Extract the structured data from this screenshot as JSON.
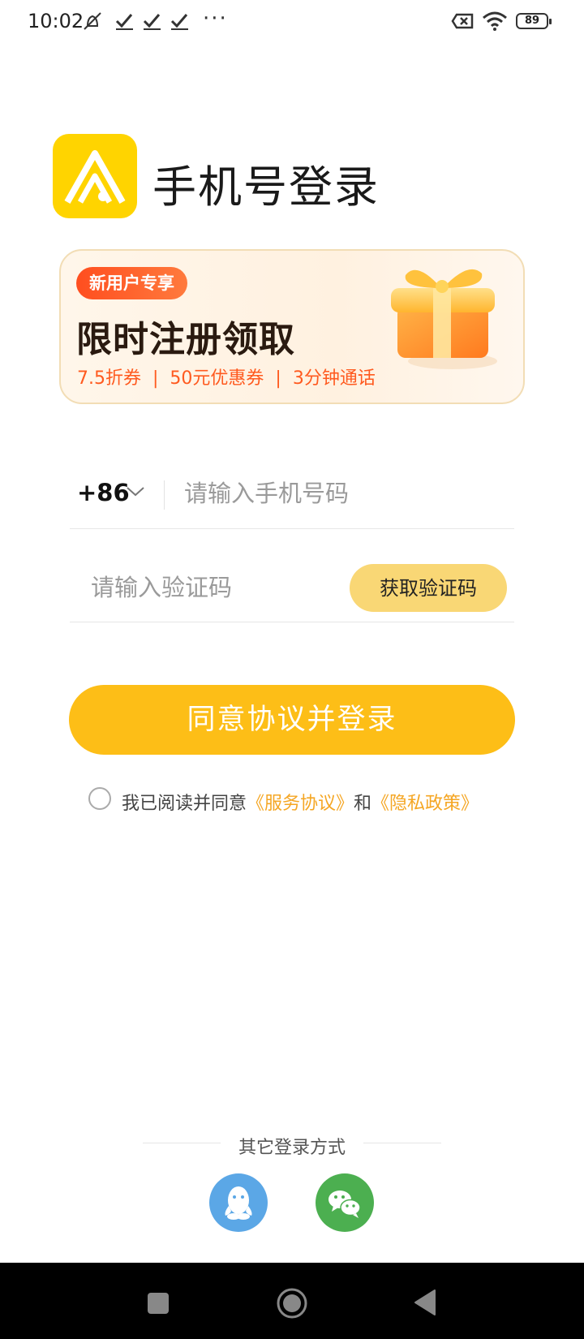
{
  "status_bar": {
    "time": "10:02",
    "battery": "89",
    "icons": [
      "mute-icon",
      "check-icon",
      "check-icon",
      "check-icon",
      "more-dots-icon",
      "sim-none-icon",
      "wifi-icon",
      "battery-icon"
    ]
  },
  "header": {
    "title": "手机号登录",
    "logo_color": "#FFD400"
  },
  "promo": {
    "badge": "新用户专享",
    "title": "限时注册领取",
    "perks": [
      "7.5折券",
      "50元优惠券",
      "3分钟通话"
    ],
    "separator": "|"
  },
  "form": {
    "country_code": "+86",
    "phone_placeholder": "请输入手机号码",
    "phone_value": "",
    "code_placeholder": "请输入验证码",
    "code_value": "",
    "get_code_label": "获取验证码"
  },
  "login_button": {
    "label": "同意协议并登录",
    "color": "#FDBE17"
  },
  "agreement": {
    "checked": false,
    "prefix": "我已阅读并同意",
    "service_link": "《服务协议》",
    "and": "和",
    "privacy_link": "《隐私政策》",
    "link_color": "#F5A623"
  },
  "other_login": {
    "label": "其它登录方式",
    "options": [
      "qq-icon",
      "wechat-icon"
    ]
  },
  "nav_bar": {
    "buttons": [
      "recent-apps-icon",
      "home-icon",
      "back-icon"
    ]
  }
}
